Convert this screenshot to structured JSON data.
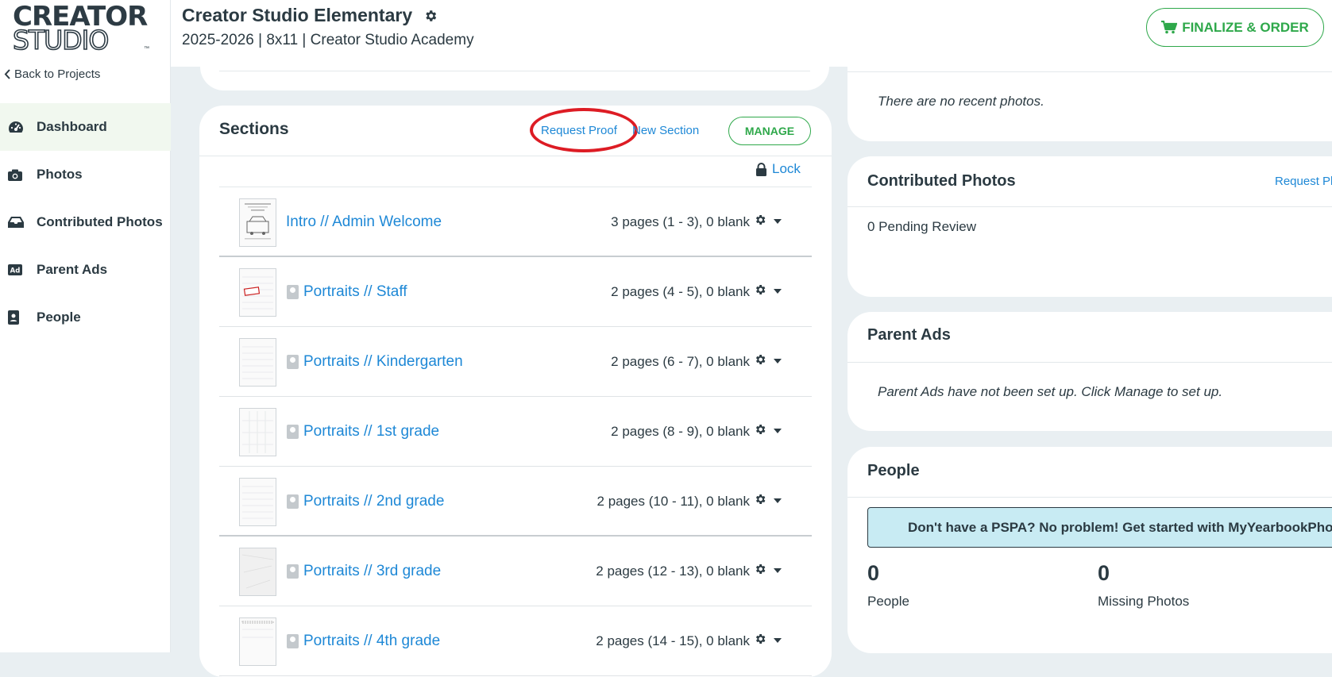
{
  "brand": {
    "line1": "CREATOR",
    "line2": "STUDIO",
    "tm": "™"
  },
  "sidebar": {
    "back_label": "Back to Projects",
    "items": [
      {
        "label": "Dashboard",
        "icon": "gauge-icon",
        "active": true
      },
      {
        "label": "Photos",
        "icon": "camera-icon",
        "active": false
      },
      {
        "label": "Contributed Photos",
        "icon": "inbox-icon",
        "active": false
      },
      {
        "label": "Parent Ads",
        "icon": "ad-icon",
        "active": false
      },
      {
        "label": "People",
        "icon": "contact-card-icon",
        "active": false
      }
    ]
  },
  "header": {
    "title": "Creator Studio Elementary",
    "subtitle": "2025-2026 | 8x11 | Creator Studio Academy",
    "order_label": "FINALIZE & ORDER"
  },
  "sections": {
    "title": "Sections",
    "request_proof": "Request Proof",
    "new_section": "New Section",
    "manage": "MANAGE",
    "lock": "Lock",
    "rows": [
      {
        "name": "Intro // Admin Welcome",
        "pages": "3 pages (1 - 3), 0 blank",
        "portrait": false
      },
      {
        "name": "Portraits // Staff",
        "pages": "2 pages (4 - 5), 0 blank",
        "portrait": true
      },
      {
        "name": "Portraits // Kindergarten",
        "pages": "2 pages (6 - 7), 0 blank",
        "portrait": true
      },
      {
        "name": "Portraits // 1st grade",
        "pages": "2 pages (8 - 9), 0 blank",
        "portrait": true
      },
      {
        "name": "Portraits // 2nd grade",
        "pages": "2 pages (10 - 11), 0 blank",
        "portrait": true
      },
      {
        "name": "Portraits // 3rd grade",
        "pages": "2 pages (12 - 13), 0 blank",
        "portrait": true
      },
      {
        "name": "Portraits // 4th grade",
        "pages": "2 pages (14 - 15), 0 blank",
        "portrait": true
      }
    ]
  },
  "recent": {
    "empty_text": "There are no recent photos."
  },
  "contributed": {
    "title": "Contributed Photos",
    "request_link": "Request Ph",
    "pending": "0 Pending Review"
  },
  "parent_ads": {
    "title": "Parent Ads",
    "empty_text": "Parent Ads have not been set up. Click Manage to set up."
  },
  "people": {
    "title": "People",
    "banner": "Don't have a PSPA? No problem! Get started with MyYearbookPhoto",
    "people_count": "0",
    "people_label": "People",
    "missing_count": "0",
    "missing_label": "Missing Photos"
  },
  "colors": {
    "accent_green": "#2ea84a",
    "link_blue": "#1e88d6",
    "annotation_red": "#dd1c24",
    "banner_bg": "#c8ebf3"
  }
}
